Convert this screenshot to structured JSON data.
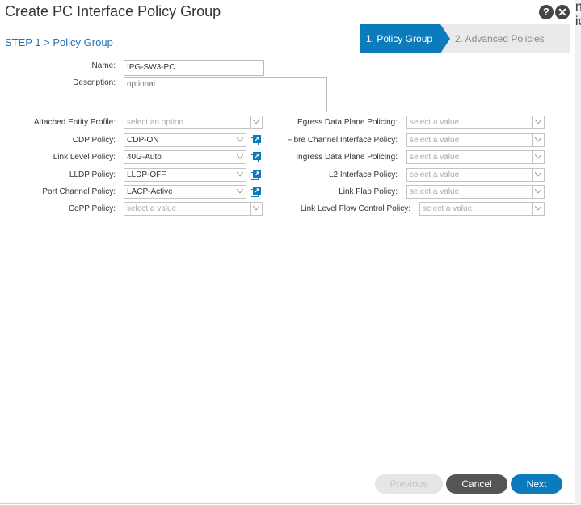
{
  "dialog": {
    "title": "Create PC Interface Policy Group",
    "help_icon_glyph": "?",
    "close_icon_glyph": "✕",
    "step_label": "STEP 1 > Policy Group"
  },
  "wizard": {
    "steps": [
      {
        "label": "1. Policy Group",
        "active": true
      },
      {
        "label": "2. Advanced Policies",
        "active": false
      }
    ]
  },
  "form": {
    "name": {
      "label": "Name:",
      "value": "IPG-SW3-PC"
    },
    "description": {
      "label": "Description:",
      "placeholder": "optional"
    },
    "left_fields": [
      {
        "label": "Attached Entity Profile:",
        "value": "select an option",
        "placeholder": true,
        "has_link": false
      },
      {
        "label": "CDP Policy:",
        "value": "CDP-ON",
        "placeholder": false,
        "has_link": true
      },
      {
        "label": "Link Level Policy:",
        "value": "40G-Auto",
        "placeholder": false,
        "has_link": true
      },
      {
        "label": "LLDP Policy:",
        "value": "LLDP-OFF",
        "placeholder": false,
        "has_link": true
      },
      {
        "label": "Port Channel Policy:",
        "value": "LACP-Active",
        "placeholder": false,
        "has_link": true
      },
      {
        "label": "CoPP Policy:",
        "value": "select a value",
        "placeholder": true,
        "has_link": false
      }
    ],
    "right_fields": [
      {
        "label": "Egress Data Plane Policing:",
        "value": "select a value"
      },
      {
        "label": "Fibre Channel Interface Policy:",
        "value": "select a value"
      },
      {
        "label": "Ingress Data Plane Policing:",
        "value": "select a value"
      },
      {
        "label": "L2 Interface Policy:",
        "value": "select a value"
      },
      {
        "label": "Link Flap Policy:",
        "value": "select a value"
      },
      {
        "label": "Link Level Flow Control Policy:",
        "value": "select a value"
      }
    ]
  },
  "footer": {
    "previous_label": "Previous",
    "cancel_label": "Cancel",
    "next_label": "Next"
  },
  "background_fragment": "n\nic",
  "colors": {
    "accent": "#0b7bbb",
    "link_blue": "#1d71b8",
    "cancel_bg": "#555555",
    "disabled_bg": "#e6e6e6"
  },
  "icons": {
    "help": "question-circle-icon",
    "close": "close-circle-icon",
    "select": "chevron-down-icon",
    "external": "open-external-icon"
  }
}
